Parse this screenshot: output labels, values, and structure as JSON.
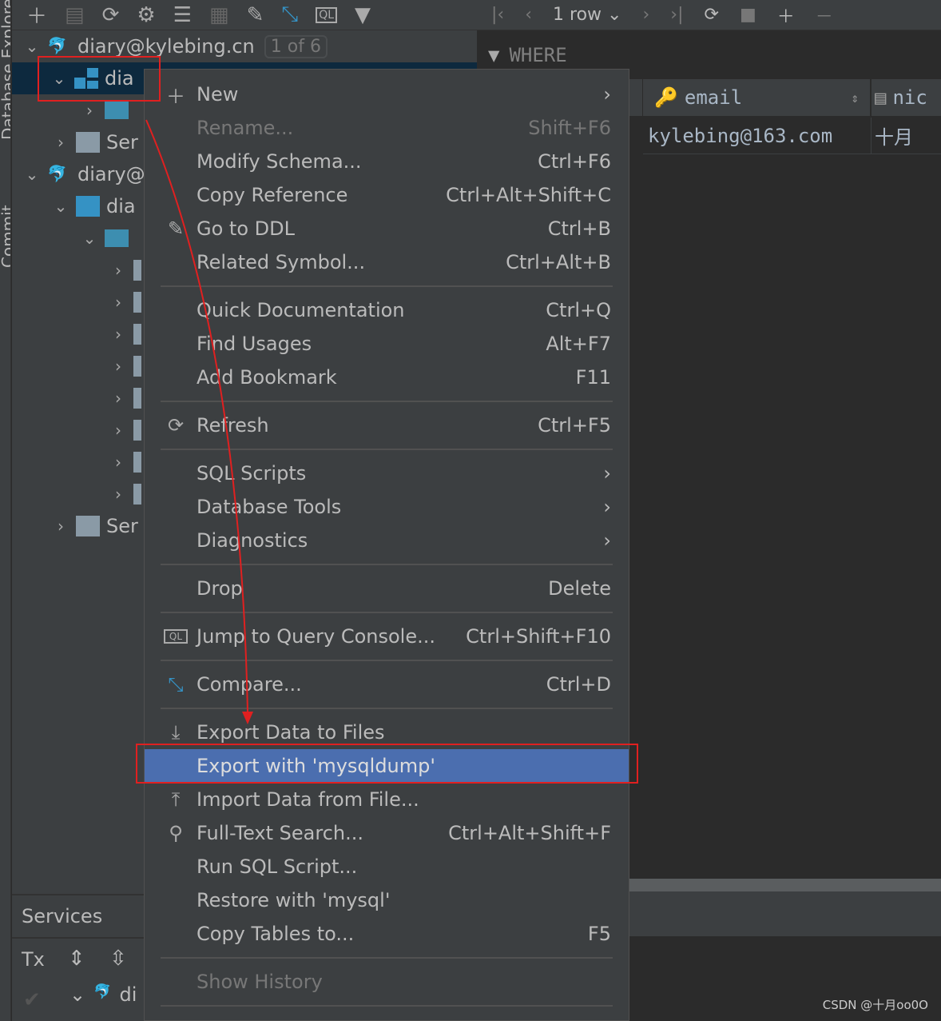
{
  "side_stripe": {
    "label": "Database Explorer",
    "commit_label": "Commit"
  },
  "left_toolbar": {
    "icons": [
      "plus-icon",
      "properties-icon",
      "refresh-icon",
      "data-source-tools-icon",
      "stop-db-icon",
      "table-icon",
      "edit-icon",
      "compare-icon",
      "console-icon",
      "filter-icon"
    ]
  },
  "tree": {
    "conn1": "diary@kylebing.cn",
    "conn1_badge": "1 of 6",
    "schema1": "dia",
    "services1": "Ser",
    "conn2": "diary@",
    "schema2": "dia",
    "services2": "Ser"
  },
  "right_toolbar": {
    "rows": "1 row"
  },
  "filter": {
    "label": "WHERE"
  },
  "grid": {
    "columns": [
      "email",
      "nic"
    ],
    "row": [
      "kylebing@163.com",
      "十月"
    ]
  },
  "services": {
    "title": "Services",
    "tx": "Tx",
    "node": "di"
  },
  "menu": {
    "items": [
      {
        "label": "New",
        "shortcut": "",
        "icon": "plus-icon",
        "submenu": true
      },
      {
        "label": "Rename...",
        "shortcut": "Shift+F6",
        "disabled": true
      },
      {
        "label": "Modify Schema...",
        "shortcut": "Ctrl+F6"
      },
      {
        "label": "Copy Reference",
        "shortcut": "Ctrl+Alt+Shift+C"
      },
      {
        "label": "Go to DDL",
        "shortcut": "Ctrl+B",
        "icon": "edit-icon"
      },
      {
        "label": "Related Symbol...",
        "shortcut": "Ctrl+Alt+B"
      },
      {
        "sep": true
      },
      {
        "label": "Quick Documentation",
        "shortcut": "Ctrl+Q"
      },
      {
        "label": "Find Usages",
        "shortcut": "Alt+F7"
      },
      {
        "label": "Add Bookmark",
        "shortcut": "F11"
      },
      {
        "sep": true
      },
      {
        "label": "Refresh",
        "shortcut": "Ctrl+F5",
        "icon": "refresh-icon"
      },
      {
        "sep": true
      },
      {
        "label": "SQL Scripts",
        "shortcut": "",
        "submenu": true
      },
      {
        "label": "Database Tools",
        "shortcut": "",
        "submenu": true
      },
      {
        "label": "Diagnostics",
        "shortcut": "",
        "submenu": true
      },
      {
        "sep": true
      },
      {
        "label": "Drop",
        "shortcut": "Delete"
      },
      {
        "sep": true
      },
      {
        "label": "Jump to Query Console...",
        "shortcut": "Ctrl+Shift+F10",
        "icon": "console-icon"
      },
      {
        "sep": true
      },
      {
        "label": "Compare...",
        "shortcut": "Ctrl+D",
        "icon": "compare-icon"
      },
      {
        "sep": true
      },
      {
        "label": "Export Data to Files",
        "shortcut": "",
        "icon": "download-icon"
      },
      {
        "label": "Export with 'mysqldump'",
        "shortcut": "",
        "highlighted": true
      },
      {
        "label": "Import Data from File...",
        "shortcut": "",
        "icon": "upload-icon"
      },
      {
        "label": "Full-Text Search...",
        "shortcut": "Ctrl+Alt+Shift+F",
        "icon": "search-icon"
      },
      {
        "label": "Run SQL Script...",
        "shortcut": ""
      },
      {
        "label": "Restore with 'mysql'",
        "shortcut": ""
      },
      {
        "label": "Copy Tables to...",
        "shortcut": "F5"
      },
      {
        "sep": true
      },
      {
        "label": "Show History",
        "shortcut": "",
        "disabled": true
      },
      {
        "sep": true
      }
    ]
  },
  "colors": {
    "menu_bg": "#3c3f41",
    "highlight": "#4b6eaf",
    "annotation": "#e02020",
    "selection": "#0d293e"
  },
  "watermark": "CSDN @十月oo0O"
}
